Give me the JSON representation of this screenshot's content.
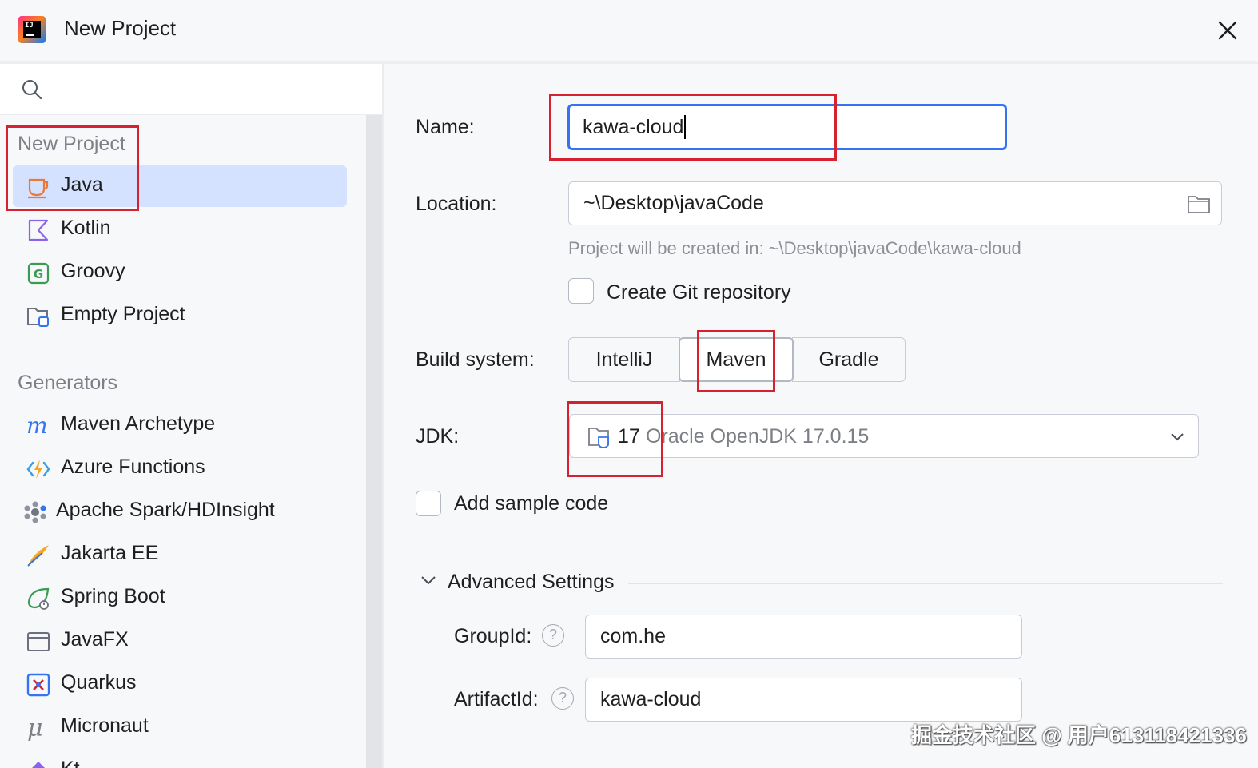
{
  "window": {
    "title": "New Project"
  },
  "sidebar": {
    "sections": [
      {
        "title": "New Project",
        "items": [
          {
            "label": "Java",
            "icon": "java-cup-icon",
            "selected": true
          },
          {
            "label": "Kotlin",
            "icon": "kotlin-icon"
          },
          {
            "label": "Groovy",
            "icon": "groovy-icon"
          },
          {
            "label": "Empty Project",
            "icon": "empty-project-icon"
          }
        ]
      },
      {
        "title": "Generators",
        "items": [
          {
            "label": "Maven Archetype",
            "icon": "maven-archetype-icon"
          },
          {
            "label": "Azure Functions",
            "icon": "azure-functions-icon"
          },
          {
            "label": "Apache Spark/HDInsight",
            "icon": "apache-spark-icon"
          },
          {
            "label": "Jakarta EE",
            "icon": "jakarta-ee-icon"
          },
          {
            "label": "Spring Boot",
            "icon": "spring-boot-icon"
          },
          {
            "label": "JavaFX",
            "icon": "javafx-icon"
          },
          {
            "label": "Quarkus",
            "icon": "quarkus-icon"
          },
          {
            "label": "Micronaut",
            "icon": "micronaut-icon"
          },
          {
            "label": "Kt",
            "icon": "ktor-icon"
          }
        ]
      }
    ]
  },
  "form": {
    "name_label": "Name:",
    "name_value": "kawa-cloud",
    "location_label": "Location:",
    "location_value": "~\\Desktop\\javaCode",
    "location_hint": "Project will be created in: ~\\Desktop\\javaCode\\kawa-cloud",
    "git_label": "Create Git repository",
    "git_checked": false,
    "build_label": "Build system:",
    "build_options": [
      "IntelliJ",
      "Maven",
      "Gradle"
    ],
    "build_selected": "Maven",
    "jdk_label": "JDK:",
    "jdk_version": "17",
    "jdk_name": "Oracle OpenJDK 17.0.15",
    "sample_label": "Add sample code",
    "sample_checked": false,
    "advanced_label": "Advanced Settings",
    "groupid_label": "GroupId:",
    "groupid_value": "com.he",
    "artifactid_label": "ArtifactId:",
    "artifactid_value": "kawa-cloud",
    "help_glyph": "?"
  },
  "watermark": "掘金技术社区 @ 用户613118421336",
  "colors": {
    "accent": "#3574f0",
    "selection": "#d4e2ff",
    "annotation": "#d6212f"
  }
}
